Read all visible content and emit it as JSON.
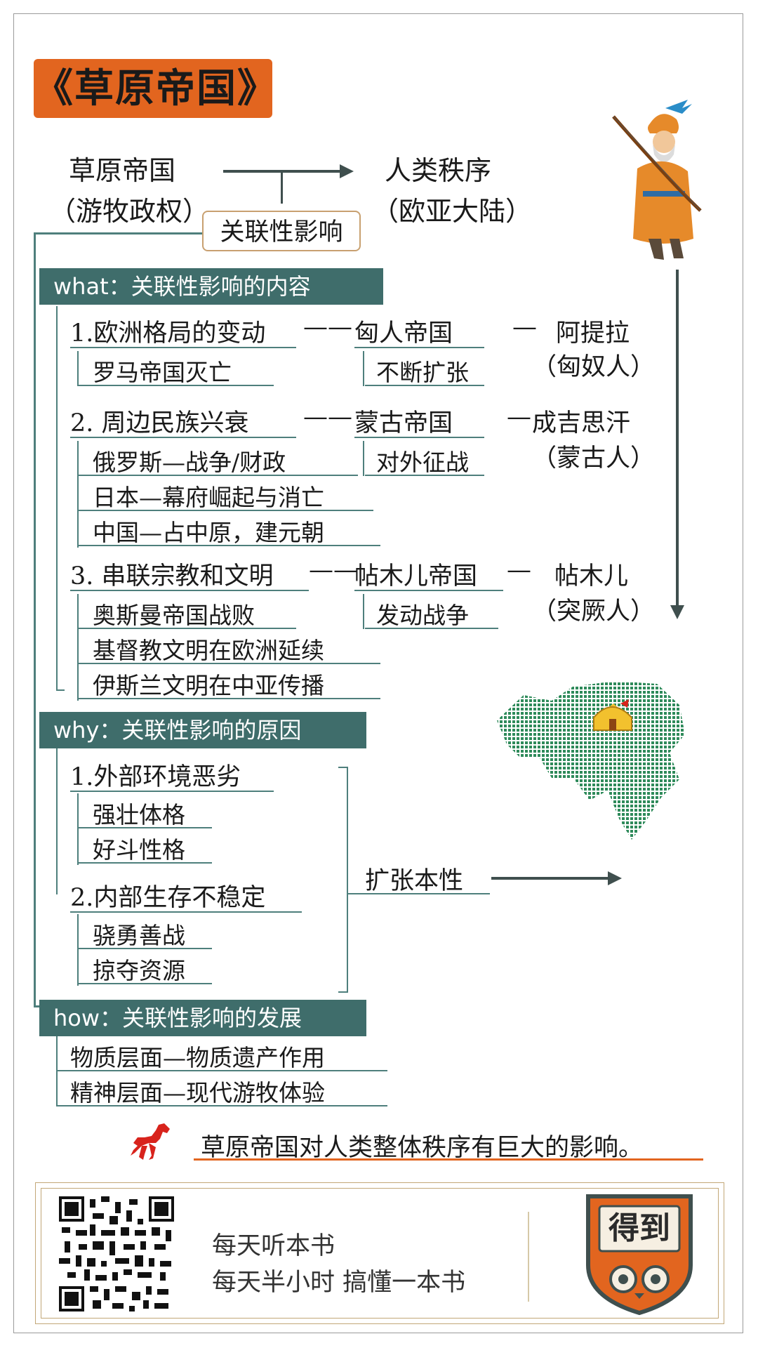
{
  "title": "《草原帝国》",
  "top": {
    "left_line1": "草原帝国",
    "left_line2": "（游牧政权）",
    "right_line1": "人类秩序",
    "right_line2": "（欧亚大陆）",
    "center_box": "关联性影响"
  },
  "what": {
    "header": "what：关联性影响的内容",
    "groups": [
      {
        "heading": "1.欧洲格局的变动",
        "dash": "——",
        "empire": "匈人帝国",
        "dash2": "—",
        "leader": "阿提拉",
        "people": "（匈奴人）",
        "empire_sub": "不断扩张",
        "effects": [
          "罗马帝国灭亡"
        ]
      },
      {
        "heading": "2. 周边民族兴衰",
        "dash": "——",
        "empire": "蒙古帝国",
        "dash2": "—",
        "leader": "成吉思汗",
        "people": "（蒙古人）",
        "empire_sub": "对外征战",
        "effects": [
          "俄罗斯—战争/财政",
          "日本—幕府崛起与消亡",
          "中国—占中原，建元朝"
        ]
      },
      {
        "heading": "3. 串联宗教和文明",
        "dash": "——",
        "empire": "帖木儿帝国",
        "dash2": "—",
        "leader": "帖木儿",
        "people": "（突厥人）",
        "empire_sub": "发动战争",
        "effects": [
          "奥斯曼帝国战败",
          "基督教文明在欧洲延续",
          "伊斯兰文明在中亚传播"
        ]
      }
    ]
  },
  "why": {
    "header": "why：关联性影响的原因",
    "groups": [
      {
        "heading": "1.外部环境恶劣",
        "items": [
          "强壮体格",
          "好斗性格"
        ]
      },
      {
        "heading": "2.内部生存不稳定",
        "items": [
          "骁勇善战",
          "掠夺资源"
        ]
      }
    ],
    "result": "扩张本性"
  },
  "how": {
    "header": "how：关联性影响的发展",
    "items": [
      "物质层面—物质遗产作用",
      "精神层面—现代游牧体验"
    ]
  },
  "conclusion": "草原帝国对人类整体秩序有巨大的影响。",
  "footer": {
    "line1": "每天听本书",
    "line2": "每天半小时 搞懂一本书",
    "logo_text": "得到"
  },
  "colors": {
    "title_bg": "#e2651f",
    "header_bg": "#3f6d6b",
    "line": "#4e7f7c",
    "conclusion_underline": "#e2651f",
    "horse": "#d8231c"
  },
  "icons": [
    "mongol-archer-illustration",
    "eurasia-map-icon",
    "yurt-icon",
    "horse-icon",
    "qr-code",
    "dedao-logo"
  ]
}
